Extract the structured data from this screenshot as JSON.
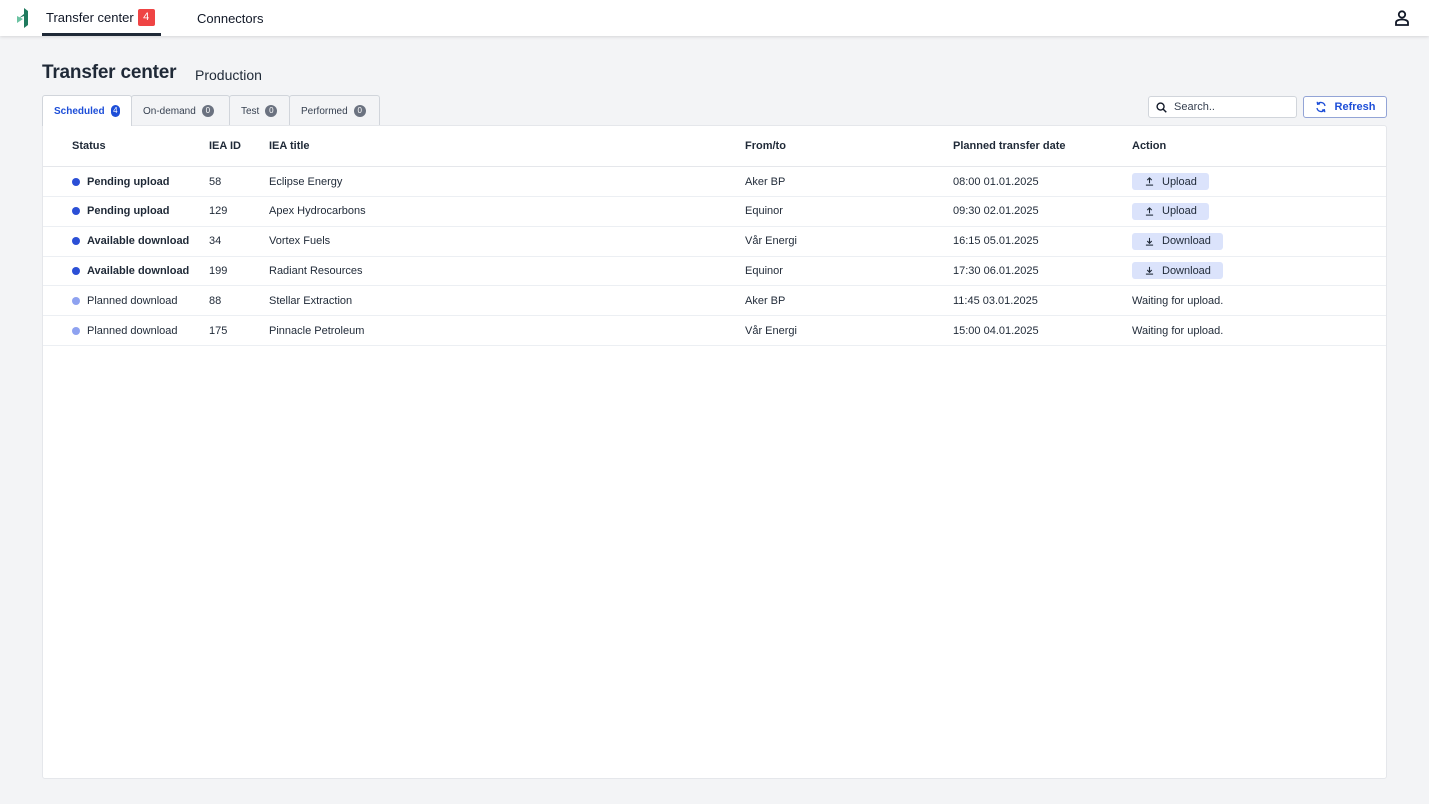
{
  "nav": {
    "items": [
      {
        "label": "Transfer center",
        "badge": "4",
        "active": true
      },
      {
        "label": "Connectors",
        "active": false
      }
    ],
    "logo_icon": "brand-logo",
    "user_icon": "user-icon"
  },
  "page": {
    "title": "Transfer center",
    "subtitle": "Production"
  },
  "tabs": [
    {
      "label": "Scheduled",
      "count": "4",
      "active": true
    },
    {
      "label": "On-demand",
      "count": "0",
      "active": false
    },
    {
      "label": "Test",
      "count": "0",
      "active": false
    },
    {
      "label": "Performed",
      "count": "0",
      "active": false
    }
  ],
  "search": {
    "placeholder": "Search..",
    "value": ""
  },
  "refresh": {
    "label": "Refresh"
  },
  "table": {
    "columns": [
      "Status",
      "IEA ID",
      "IEA title",
      "From/to",
      "Planned transfer date",
      "Action"
    ],
    "rows": [
      {
        "status": "Pending upload",
        "status_color": "#2b4fd6",
        "strong": true,
        "id": "58",
        "title": "Eclipse Energy",
        "fromto": "Aker BP",
        "date": "08:00 01.01.2025",
        "action": "Upload",
        "action_type": "upload"
      },
      {
        "status": "Pending upload",
        "status_color": "#2b4fd6",
        "strong": true,
        "id": "129",
        "title": "Apex Hydrocarbons",
        "fromto": "Equinor",
        "date": "09:30 02.01.2025",
        "action": "Upload",
        "action_type": "upload"
      },
      {
        "status": "Available download",
        "status_color": "#2b4fd6",
        "strong": true,
        "id": "34",
        "title": "Vortex Fuels",
        "fromto": "Vår Energi",
        "date": "16:15 05.01.2025",
        "action": "Download",
        "action_type": "download"
      },
      {
        "status": "Available download",
        "status_color": "#2b4fd6",
        "strong": true,
        "id": "199",
        "title": "Radiant Resources",
        "fromto": "Equinor",
        "date": "17:30 06.01.2025",
        "action": "Download",
        "action_type": "download"
      },
      {
        "status": "Planned download",
        "status_color": "#8ea2f0",
        "strong": false,
        "id": "88",
        "title": "Stellar Extraction",
        "fromto": "Aker BP",
        "date": "11:45 03.01.2025",
        "action": "Waiting for upload.",
        "action_type": "text"
      },
      {
        "status": "Planned download",
        "status_color": "#8ea2f0",
        "strong": false,
        "id": "175",
        "title": "Pinnacle Petroleum",
        "fromto": "Vår Energi",
        "date": "15:00 04.01.2025",
        "action": "Waiting for upload.",
        "action_type": "text"
      }
    ]
  },
  "colors": {
    "accent": "#1d4ed8",
    "badge": "#ef4444",
    "status_active": "#2b4fd6",
    "status_planned": "#8ea2f0",
    "action_bg": "#dbe3fb"
  }
}
